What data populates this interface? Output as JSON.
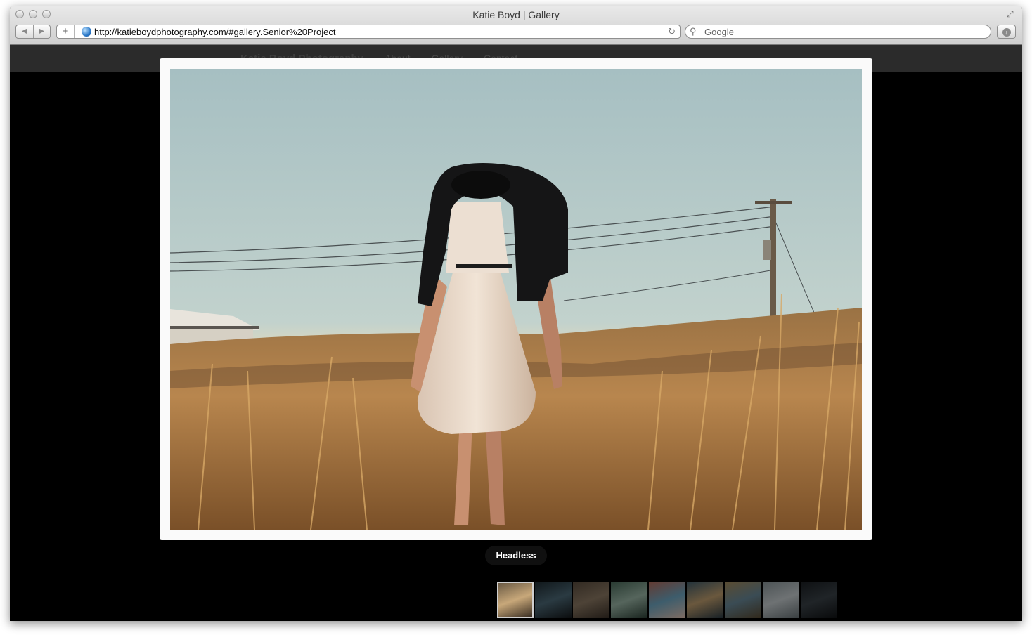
{
  "browser": {
    "title": "Katie Boyd | Gallery",
    "url": "http://katieboydphotography.com/#gallery.Senior%20Project",
    "search_placeholder": "Google",
    "back_icon": "◀",
    "forward_icon": "▶",
    "add_icon": "+",
    "reload_icon": "↻",
    "resize_icon": "⤢",
    "download_icon": "↓"
  },
  "site": {
    "brand": "Katie Boyd Photography",
    "nav": [
      "About",
      "Gallery",
      "Contact"
    ]
  },
  "lightbox": {
    "caption": "Headless"
  },
  "thumbnails": [
    {
      "name": "headless",
      "active": true,
      "colors": [
        "#6a5a44",
        "#c8a87a",
        "#3a2e22"
      ]
    },
    {
      "name": "thumb-2",
      "active": false,
      "colors": [
        "#1e2a30",
        "#4d6a78",
        "#15181a"
      ]
    },
    {
      "name": "thumb-3",
      "active": false,
      "colors": [
        "#5a4c3e",
        "#8d7a64",
        "#3b3128"
      ]
    },
    {
      "name": "thumb-4",
      "active": false,
      "colors": [
        "#4a6a5a",
        "#9cb8a8",
        "#2e4238"
      ]
    },
    {
      "name": "thumb-5",
      "active": false,
      "colors": [
        "#b46a5a",
        "#6fa8c4",
        "#e4c4b4"
      ]
    },
    {
      "name": "thumb-6",
      "active": false,
      "colors": [
        "#3e5a6a",
        "#c2a070",
        "#2a3a44"
      ]
    },
    {
      "name": "thumb-7",
      "active": false,
      "colors": [
        "#a48a5a",
        "#6a8a9a",
        "#5a4a32"
      ]
    },
    {
      "name": "thumb-8",
      "active": false,
      "colors": [
        "#8a969a",
        "#c8cfd2",
        "#6a7478"
      ]
    },
    {
      "name": "thumb-9",
      "active": false,
      "colors": [
        "#1a1e22",
        "#3a4248",
        "#101214"
      ]
    }
  ]
}
